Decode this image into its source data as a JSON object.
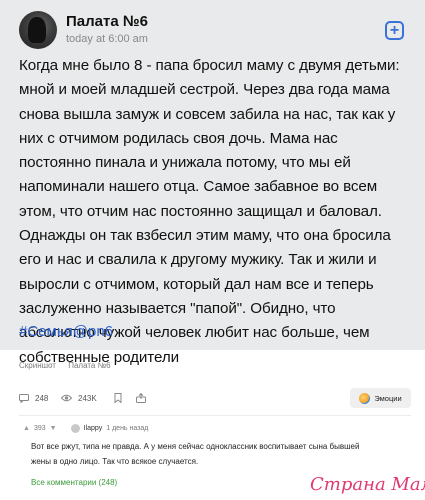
{
  "post": {
    "author": "Палата №6",
    "time": "today at 6:00 am",
    "text": "Когда мне было 8 - папа бросил маму с двумя детьми: мной и моей младшей сестрой. Через два года мама снова вышла замуж и совсем забила на нас, так как у них с отчимом родилась своя дочь. Мама нас постоянно пинала и унижала потому, что мы ей напоминали нашего отца. Самое забавное во всем этом, что отчим нас постоянно защищал и баловал. Однажды он так взбесил этим маму, что она бросила его и нас и свалила к другому мужику. Так и жили и выросли с отчимом, который дал нам все и теперь заслуженно называется \"папой\". Обидно, что абсолютно чужой человек любит нас больше, чем собственные родители",
    "hashtag": "#Семья@рn6"
  },
  "tags": [
    "Скриншот",
    "Палата №6"
  ],
  "stats": {
    "comments": "248",
    "views": "243K",
    "emoji_label": "Эмоции"
  },
  "comment": {
    "rating": "393",
    "user": "Ilappy",
    "time": "1 день назад",
    "text": "Вот все ржут, типа не правда. А у меня сейчас одноклассник воспитывает сына бывшей жены в одно лицо. Так что всякое случается.",
    "all_comments": "Все комментарии (248)"
  },
  "watermark": "Страна Мам",
  "colors": {
    "card_bg": "#e9eaeb",
    "link": "#2f63cf",
    "accent_green": "#3a9a3a",
    "watermark": "#e03a6f"
  }
}
